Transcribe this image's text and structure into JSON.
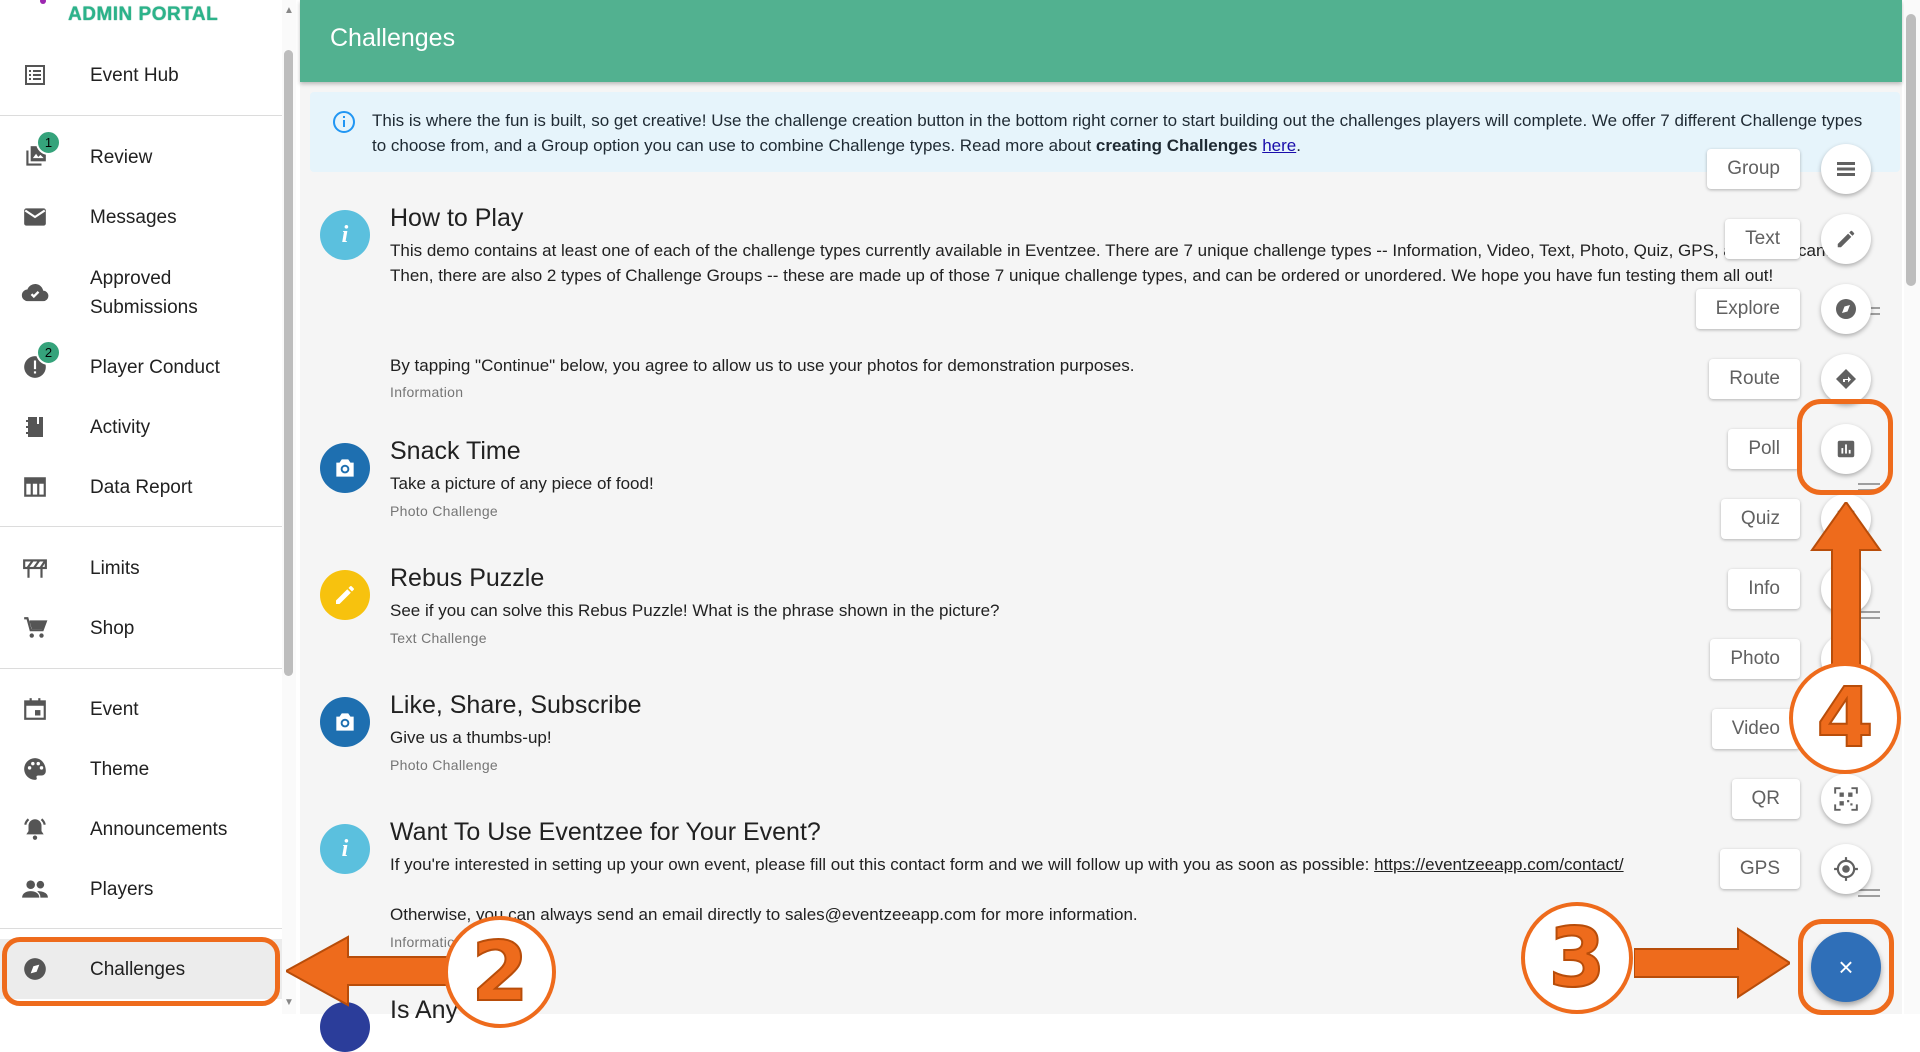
{
  "sidebar": {
    "logo": "ADMIN PORTAL",
    "items": [
      {
        "label": "Event Hub",
        "icon": "list-icon"
      },
      {
        "label": "Review",
        "icon": "photo-review-icon",
        "badge": "1"
      },
      {
        "label": "Messages",
        "icon": "mail-icon"
      },
      {
        "label": "Approved Submissions",
        "icon": "cloud-check-icon"
      },
      {
        "label": "Player Conduct",
        "icon": "alert-icon",
        "badge": "2"
      },
      {
        "label": "Activity",
        "icon": "notebook-icon"
      },
      {
        "label": "Data Report",
        "icon": "table-icon"
      },
      {
        "label": "Limits",
        "icon": "barrier-icon"
      },
      {
        "label": "Shop",
        "icon": "cart-icon"
      },
      {
        "label": "Event",
        "icon": "calendar-icon"
      },
      {
        "label": "Theme",
        "icon": "palette-icon"
      },
      {
        "label": "Announcements",
        "icon": "bell-ring-icon"
      },
      {
        "label": "Players",
        "icon": "people-icon"
      },
      {
        "label": "Challenges",
        "icon": "compass-icon",
        "active": true
      }
    ]
  },
  "header": {
    "title": "Challenges"
  },
  "banner": {
    "text": "This is where the fun is built, so get creative! Use the challenge creation button in the bottom right corner to start building out the challenges players will complete. We offer 7 different Challenge types to choose from, and a Group option you can use to combine Challenge types. Read more about ",
    "bold": "creating Challenges",
    "link": "here",
    "end": "."
  },
  "challenges": [
    {
      "title": "How to Play",
      "desc": "This demo contains at least one of each of the challenge types currently available in Eventzee. There are 7 unique challenge types -- Information, Video, Text, Photo, Quiz, GPS, and QR Scan. Then, there are also 2 types of Challenge Groups -- these are made up of those 7 unique challenge types, and can be ordered or unordered. We hope you have fun testing them all out!",
      "desc2": "By tapping \"Continue\" below, you agree to allow us to use your photos for demonstration purposes.",
      "type": "Information",
      "avatar": "info-icon",
      "color": "#5bc0de"
    },
    {
      "title": "Snack Time",
      "desc": "Take a picture of any piece of food!",
      "type": "Photo Challenge",
      "avatar": "camera-icon",
      "color": "#1e6fb0"
    },
    {
      "title": "Rebus Puzzle",
      "desc": "See if you can solve this Rebus Puzzle! What is the phrase shown in the picture?",
      "type": "Text Challenge",
      "avatar": "pencil-icon",
      "color": "#f7c20e"
    },
    {
      "title": "Like, Share, Subscribe",
      "desc": "Give us a thumbs-up!",
      "type": "Photo Challenge",
      "avatar": "camera-icon",
      "color": "#1e6fb0"
    },
    {
      "title": "Want To Use Eventzee for Your Event?",
      "desc": "If you're interested in setting up your own event, please fill out this contact form and we will follow up with you as soon as possible: ",
      "link": "https://eventzeeapp.com/contact/",
      "desc2": "Otherwise, you can always send an email directly to sales@eventzeeapp.com for more information.",
      "type": "Information",
      "avatar": "info-icon",
      "color": "#5bc0de"
    },
    {
      "title": "Is Any",
      "avatar": "dot-icon",
      "color": "#2b3d9a"
    }
  ],
  "speed_dial": [
    {
      "label": "Group",
      "icon": "group-icon"
    },
    {
      "label": "Text",
      "icon": "pencil-icon"
    },
    {
      "label": "Explore",
      "icon": "compass-icon"
    },
    {
      "label": "Route",
      "icon": "route-icon"
    },
    {
      "label": "Poll",
      "icon": "poll-icon"
    },
    {
      "label": "Quiz",
      "icon": "quiz-icon"
    },
    {
      "label": "Info",
      "icon": "info-icon"
    },
    {
      "label": "Photo",
      "icon": "camera-icon"
    },
    {
      "label": "Video",
      "icon": "video-icon"
    },
    {
      "label": "QR",
      "icon": "qr-icon"
    },
    {
      "label": "GPS",
      "icon": "gps-icon"
    }
  ],
  "fab": {
    "label": "×"
  },
  "annotations": [
    "2",
    "3",
    "4"
  ]
}
